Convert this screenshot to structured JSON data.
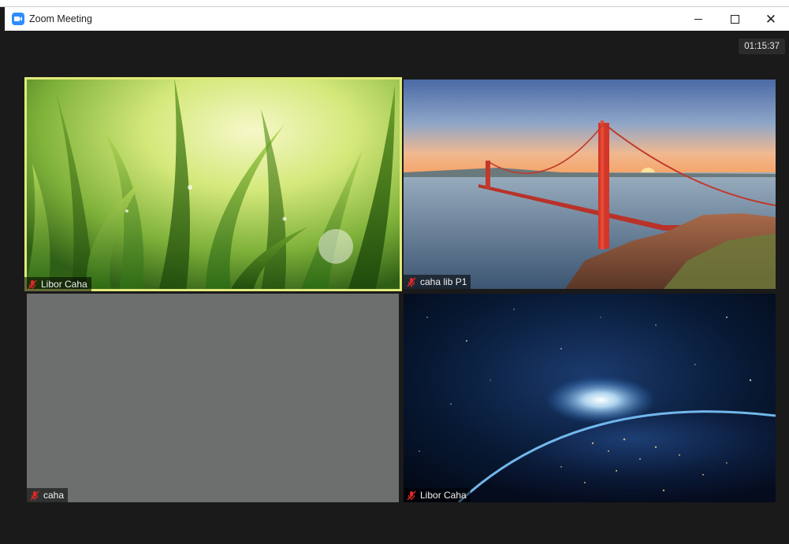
{
  "window": {
    "title": "Zoom Meeting",
    "controls": {
      "minimize": "minimize",
      "maximize": "maximize",
      "close": "close"
    }
  },
  "meeting": {
    "timer": "01:15:37"
  },
  "participants": [
    {
      "name": "Libor Caha",
      "muted": true,
      "active_speaker": true,
      "background": "green grass with dew drops"
    },
    {
      "name": "caha lib P1",
      "muted": true,
      "active_speaker": false,
      "background": "Golden Gate Bridge at sunset"
    },
    {
      "name": "caha",
      "muted": true,
      "active_speaker": false,
      "background": "plain gray"
    },
    {
      "name": "Libor Caha",
      "muted": true,
      "active_speaker": false,
      "background": "earth from space with sunrise"
    }
  ],
  "colors": {
    "meeting_bg": "#1a1a1a",
    "active_speaker_border": "#e2ea7a",
    "muted_mic": "#e02828",
    "zoom_blue": "#2d8cff"
  }
}
